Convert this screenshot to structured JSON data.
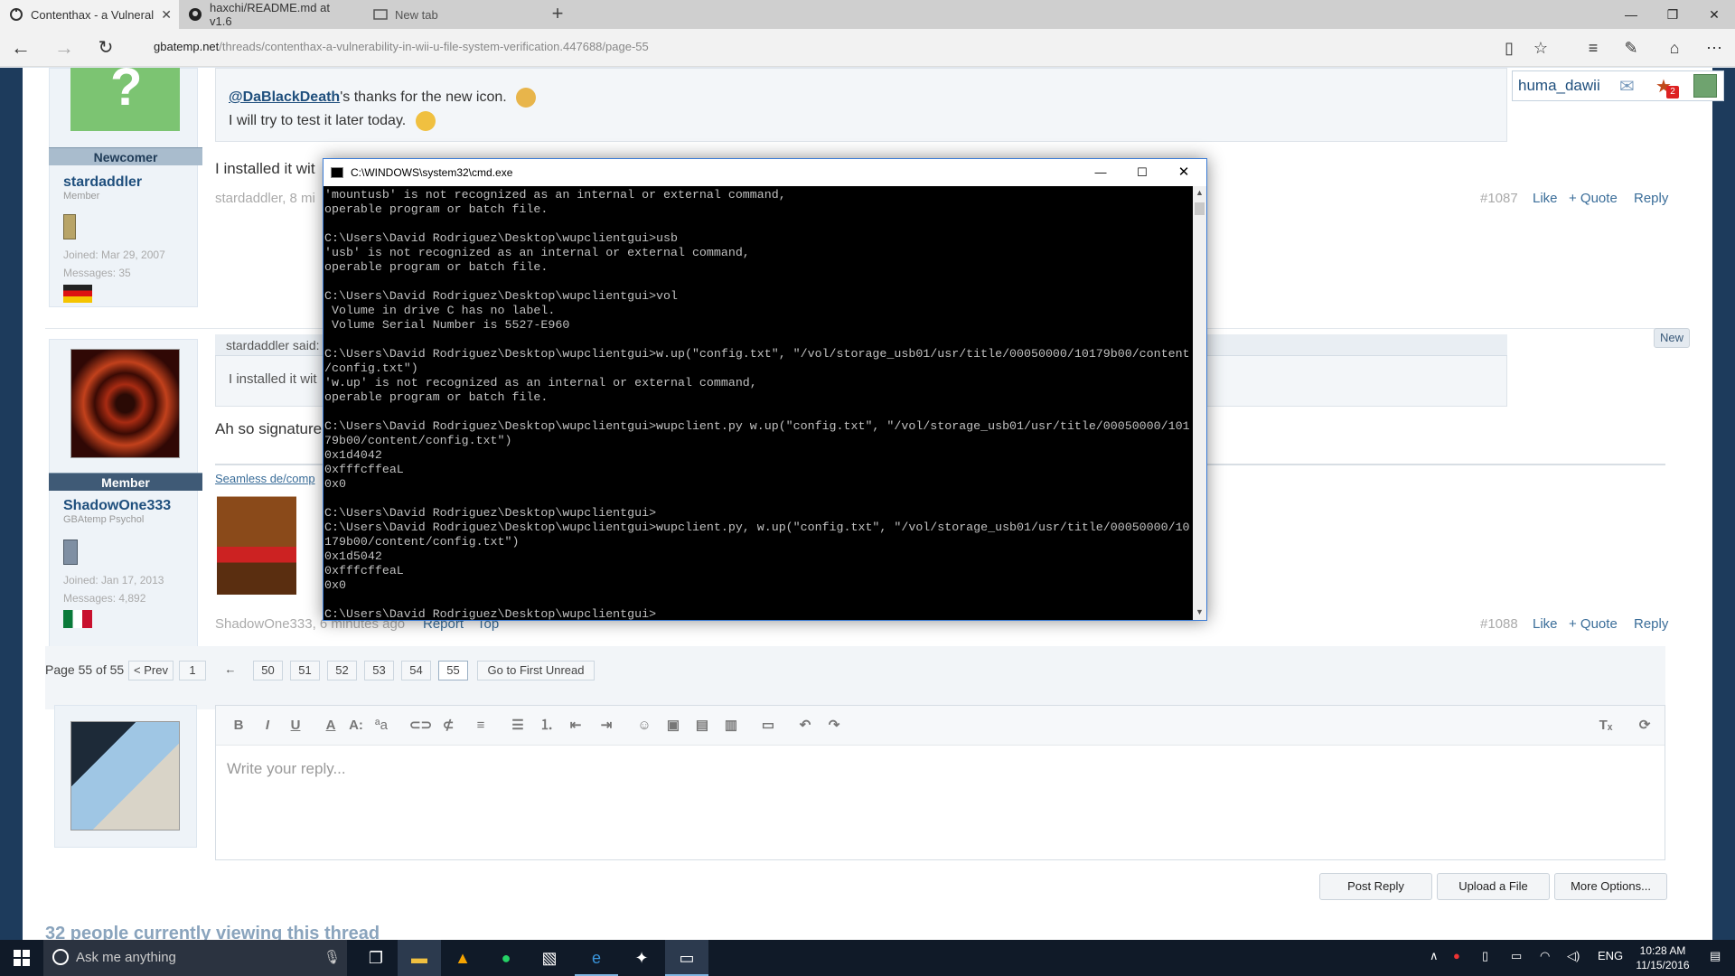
{
  "browser": {
    "tabs": [
      {
        "label": "Contenthax - a Vulneral",
        "active": true,
        "icon": "gbatemp-icon"
      },
      {
        "label": "haxchi/README.md at v1.6",
        "active": false,
        "icon": "github-icon"
      },
      {
        "label": "New tab",
        "active": false,
        "icon": "newtab-icon"
      }
    ],
    "url_host": "gbatemp.net",
    "url_path": "/threads/contenthax-a-vulnerability-in-wii-u-file-system-verification.447688/page-55"
  },
  "header_user": {
    "name": "huma_dawii",
    "alerts_badge": "2"
  },
  "posts": {
    "top": {
      "user_title": "Newcomer",
      "username": "stardaddler",
      "role": "Member",
      "joined": "Joined: Mar 29, 2007",
      "messages": "Messages: 35",
      "mention": "@DaBlackDeath",
      "line1_rest": "'s thanks for the new icon.",
      "line2": "I will try to test it later today.",
      "body_start": "I installed it wit",
      "meta": "stardaddler, 8 mi",
      "number": "#1087",
      "like": "Like",
      "quote": "+ Quote",
      "reply": "Reply"
    },
    "second": {
      "user_title": "Member",
      "username": "ShadowOne333",
      "role": "GBAtemp Psychol",
      "joined": "Joined: Jan 17, 2013",
      "messages": "Messages: 4,892",
      "quote_head": "stardaddler said:",
      "quote_body": "I installed it wit",
      "body_start": "Ah so signature",
      "signature_link": "Seamless de/comp",
      "new_badge": "New",
      "meta": "ShadowOne333, 6 minutes ago",
      "report": "Report",
      "top": "Top",
      "number": "#1088",
      "like": "Like",
      "quote": "+ Quote",
      "reply": "Reply"
    }
  },
  "pagination": {
    "label": "Page 55 of 55",
    "prev": "< Prev",
    "first": "1",
    "ellipsis": "←",
    "pages": [
      "50",
      "51",
      "52",
      "53",
      "54",
      "55"
    ],
    "first_unread": "Go to First Unread"
  },
  "editor": {
    "placeholder": "Write your reply...",
    "post_reply": "Post Reply",
    "upload": "Upload a File",
    "more": "More Options..."
  },
  "viewing": "32 people currently viewing this thread",
  "cmd": {
    "title": "C:\\WINDOWS\\system32\\cmd.exe",
    "lines": [
      "'mountusb' is not recognized as an internal or external command,",
      "operable program or batch file.",
      "",
      "C:\\Users\\David Rodriguez\\Desktop\\wupclientgui>usb",
      "'usb' is not recognized as an internal or external command,",
      "operable program or batch file.",
      "",
      "C:\\Users\\David Rodriguez\\Desktop\\wupclientgui>vol",
      " Volume in drive C has no label.",
      " Volume Serial Number is 5527-E960",
      "",
      "C:\\Users\\David Rodriguez\\Desktop\\wupclientgui>w.up(\"config.txt\", \"/vol/storage_usb01/usr/title/00050000/10179b00/content",
      "/config.txt\")",
      "'w.up' is not recognized as an internal or external command,",
      "operable program or batch file.",
      "",
      "C:\\Users\\David Rodriguez\\Desktop\\wupclientgui>wupclient.py w.up(\"config.txt\", \"/vol/storage_usb01/usr/title/00050000/101",
      "79b00/content/config.txt\")",
      "0x1d4042",
      "0xfffcffeaL",
      "0x0",
      "",
      "C:\\Users\\David Rodriguez\\Desktop\\wupclientgui>",
      "C:\\Users\\David Rodriguez\\Desktop\\wupclientgui>wupclient.py, w.up(\"config.txt\", \"/vol/storage_usb01/usr/title/00050000/10",
      "179b00/content/config.txt\")",
      "0x1d5042",
      "0xfffcffeaL",
      "0x0",
      "",
      "C:\\Users\\David Rodriguez\\Desktop\\wupclientgui>"
    ]
  },
  "taskbar": {
    "search_placeholder": "Ask me anything",
    "lang": "ENG",
    "time": "10:28 AM",
    "date": "11/15/2016"
  },
  "colors": {
    "accent": "#1f4f7d",
    "link": "#3a6d99",
    "chrome": "#cfcfcf",
    "taskbar": "#101a28"
  }
}
